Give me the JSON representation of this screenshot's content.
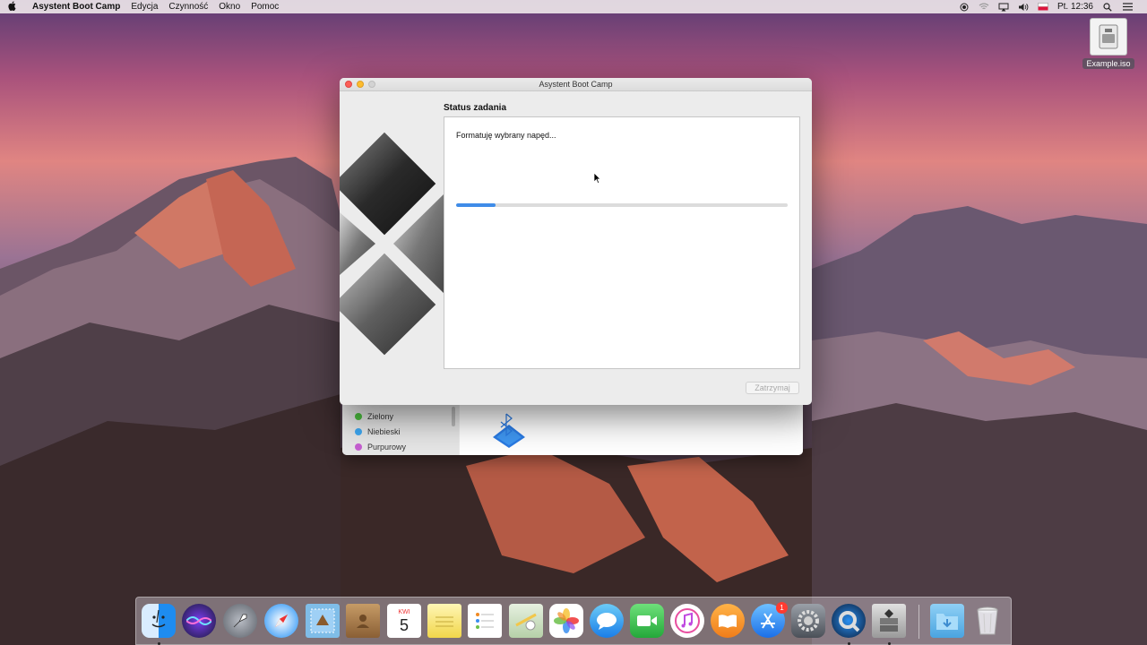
{
  "menubar": {
    "apple": "",
    "app_name": "Asystent Boot Camp",
    "menus": [
      "Edycja",
      "Czynność",
      "Okno",
      "Pomoc"
    ],
    "clock": "Pt. 12:36"
  },
  "desktop": {
    "file_label": "Example.iso"
  },
  "back_window": {
    "tags": [
      {
        "label": "Zielony",
        "color": "#4cbf3f"
      },
      {
        "label": "Niebieski",
        "color": "#3ea7f0"
      },
      {
        "label": "Purpurowy",
        "color": "#c65fd1"
      }
    ]
  },
  "window": {
    "title": "Asystent Boot Camp",
    "section_title": "Status zadania",
    "status_text": "Formatuję wybrany napęd...",
    "progress": 0.12,
    "stop_label": "Zatrzymaj"
  },
  "dock": {
    "calendar_month": "KWI",
    "calendar_day": "5",
    "appstore_badge": "1"
  }
}
